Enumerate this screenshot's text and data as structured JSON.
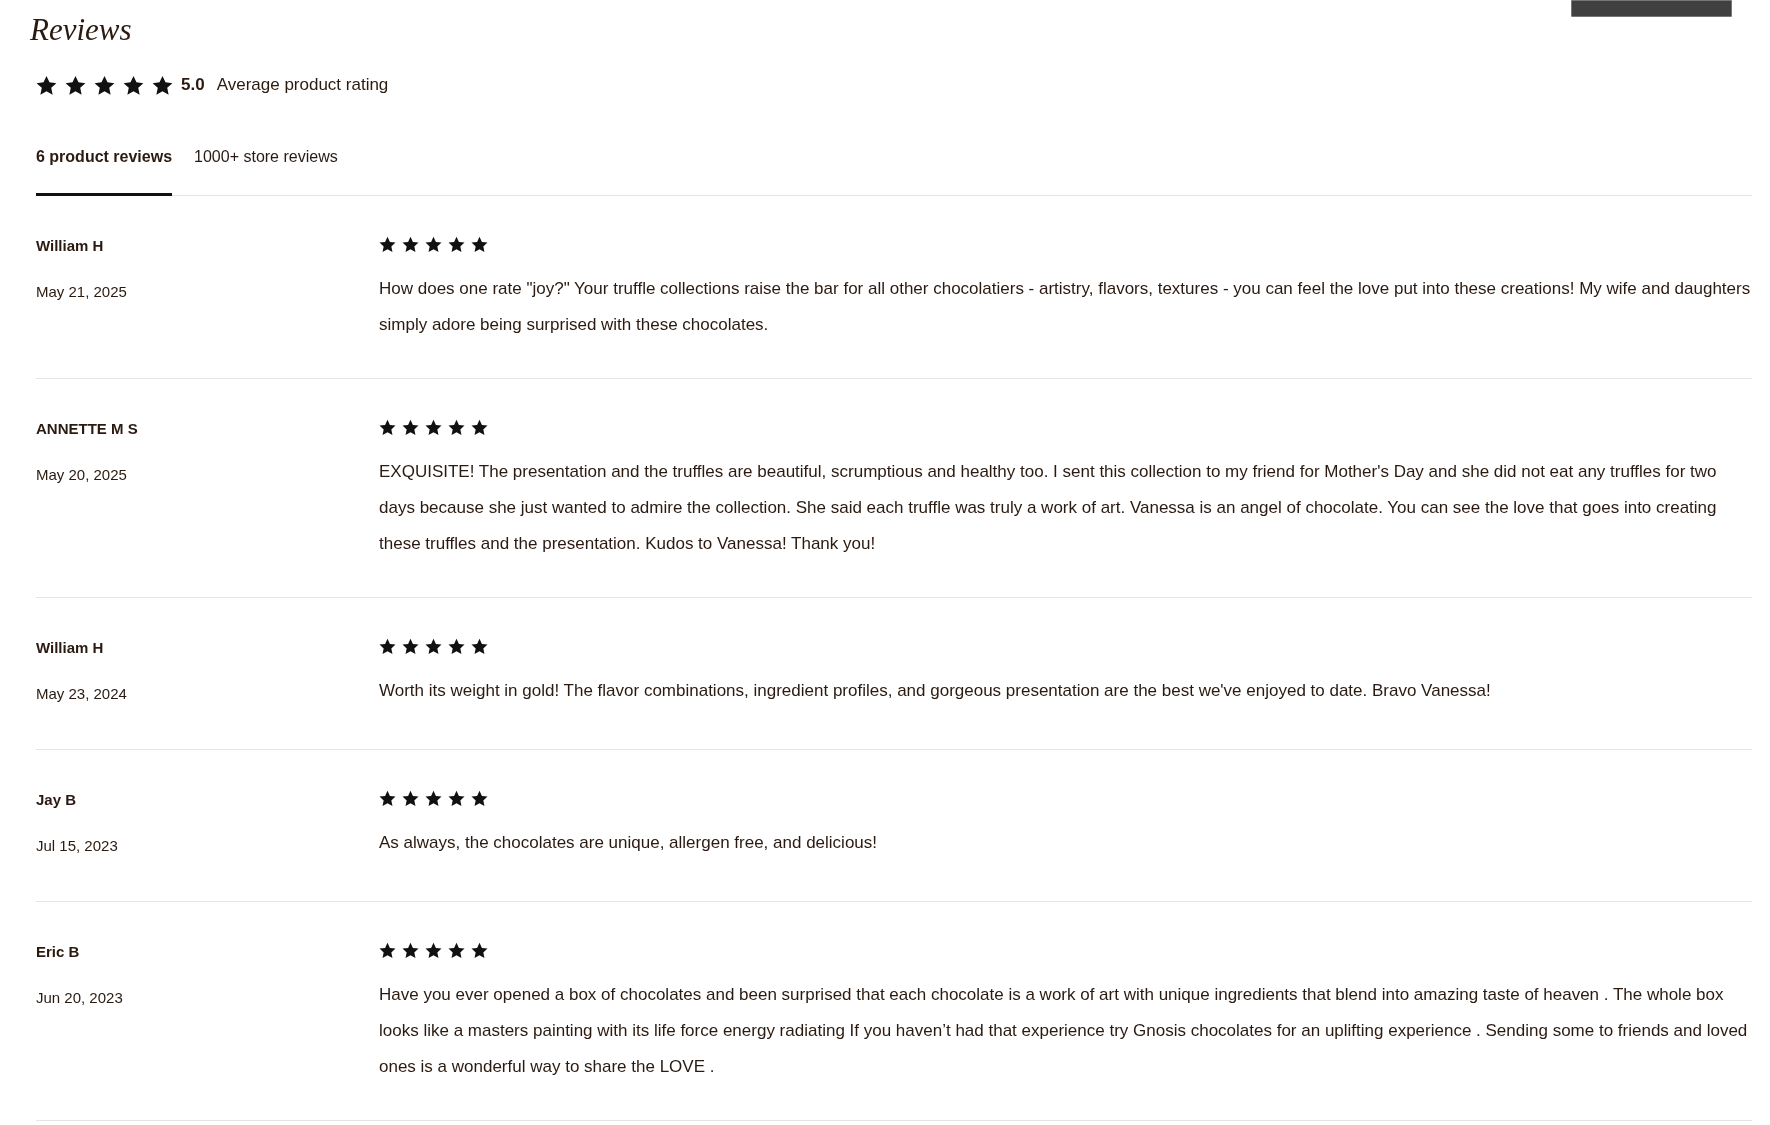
{
  "title": "Reviews",
  "summary": {
    "stars": 5,
    "score": "5.0",
    "label": "Average product rating"
  },
  "tabs": [
    {
      "label": "6 product reviews",
      "selected": true
    },
    {
      "label": "1000+ store reviews",
      "selected": false
    }
  ],
  "reviews": [
    {
      "author": "William H",
      "date": "May 21, 2025",
      "stars": 5,
      "text": "How does one rate \"joy?\" Your truffle collections raise the bar for all other chocolatiers - artistry, flavors, textures - you can feel the love put into these creations! My wife and daughters simply adore being surprised with these chocolates."
    },
    {
      "author": "ANNETTE M S",
      "date": "May 20, 2025",
      "stars": 5,
      "text": "EXQUISITE! The presentation and the truffles are beautiful, scrumptious and healthy too. I sent this collection to my friend for Mother's Day and she did not eat any truffles for two days because she just wanted to admire the collection. She said each truffle was truly a work of art. Vanessa is an angel of chocolate. You can see the love that goes into creating these truffles and the presentation. Kudos to Vanessa! Thank you!"
    },
    {
      "author": "William H",
      "date": "May 23, 2024",
      "stars": 5,
      "text": "Worth its weight in gold! The flavor combinations, ingredient profiles, and gorgeous presentation are the best we've enjoyed to date. Bravo Vanessa!"
    },
    {
      "author": "Jay B",
      "date": "Jul 15, 2023",
      "stars": 5,
      "text": "As always, the chocolates are unique, allergen free, and delicious!"
    },
    {
      "author": "Eric B",
      "date": "Jun 20, 2023",
      "stars": 5,
      "text": "Have you ever opened a box of chocolates and been surprised that each chocolate is a work of art with unique ingredients that blend into amazing taste of heaven . The whole box looks like a masters painting with its life force energy radiating If you haven’t had that experience try Gnosis chocolates for an uplifting experience . Sending some to friends and loved ones is a wonderful way to share the LOVE ."
    }
  ]
}
